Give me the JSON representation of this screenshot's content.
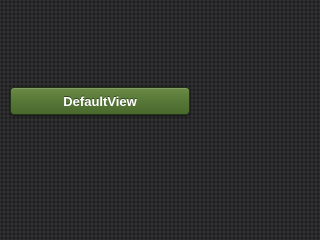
{
  "button": {
    "label": "DefaultView"
  },
  "colors": {
    "background": "#2a2a2c",
    "button_fill": "#557636",
    "button_text": "#ffffff"
  }
}
